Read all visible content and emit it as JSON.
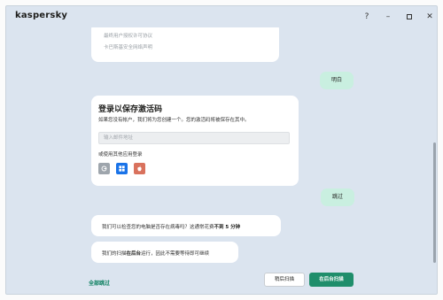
{
  "window": {
    "app_name": "kaspersky",
    "help_label": "?",
    "minimize_label": "–",
    "close_label": "✕"
  },
  "top_bubble": {
    "line1": "最终用户授权许可协议",
    "line2": "卡巴斯基安全网络声明"
  },
  "user_reply_1": "明白",
  "save_card": {
    "title": "登录以保存激活码",
    "description": "如果您没有帐户，我们将为您创建一个。您的激活码将被保存在其中。",
    "email_placeholder": "输入邮件地址",
    "email_value": "",
    "other_apps_label": "或使用其他应用登录",
    "social_icons": [
      "google-icon",
      "microsoft-icon",
      "apple-icon"
    ]
  },
  "user_reply_2": "跳过",
  "bot_question": {
    "text_before": "我们可以检查您的电脑是否存在病毒吗？这通常花费",
    "text_bold": "不到 5 分钟"
  },
  "bot_info": {
    "text_before": "我们的扫描",
    "text_bold": "在后台",
    "text_after": "运行，因此不需要等待即可继续"
  },
  "footer": {
    "skip_all": "全部跳过",
    "scan_later": "稍后扫描",
    "scan_background": "在后台扫描"
  },
  "colors": {
    "accent": "#1f8e6b",
    "window_bg": "#dbe4ef",
    "user_bubble": "#c9efe0"
  }
}
